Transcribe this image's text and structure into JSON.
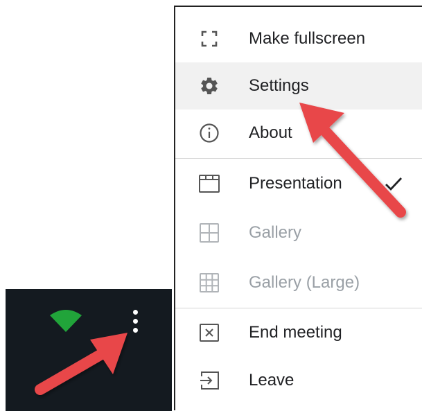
{
  "menu": {
    "items": [
      {
        "label": "Make fullscreen",
        "icon": "fullscreen-icon",
        "state": "enabled"
      },
      {
        "label": "Settings",
        "icon": "gear-icon",
        "state": "highlighted"
      },
      {
        "label": "About",
        "icon": "info-icon",
        "state": "enabled"
      },
      {
        "label": "Presentation",
        "icon": "presentation-layout-icon",
        "state": "selected"
      },
      {
        "label": "Gallery",
        "icon": "gallery-grid-icon",
        "state": "disabled"
      },
      {
        "label": "Gallery (Large)",
        "icon": "gallery-large-grid-icon",
        "state": "disabled"
      },
      {
        "label": "End meeting",
        "icon": "end-meeting-icon",
        "state": "enabled"
      },
      {
        "label": "Leave",
        "icon": "leave-icon",
        "state": "enabled"
      }
    ]
  },
  "toolbar": {
    "signal_icon": "signal-icon",
    "more_icon": "more-vertical-icon"
  },
  "colors": {
    "toolbar_bg": "#141a20",
    "signal_green": "#21a43a",
    "highlight_bg": "#f1f1f1",
    "disabled_text": "#9aa0a6",
    "annotation_red": "#e8474a"
  }
}
